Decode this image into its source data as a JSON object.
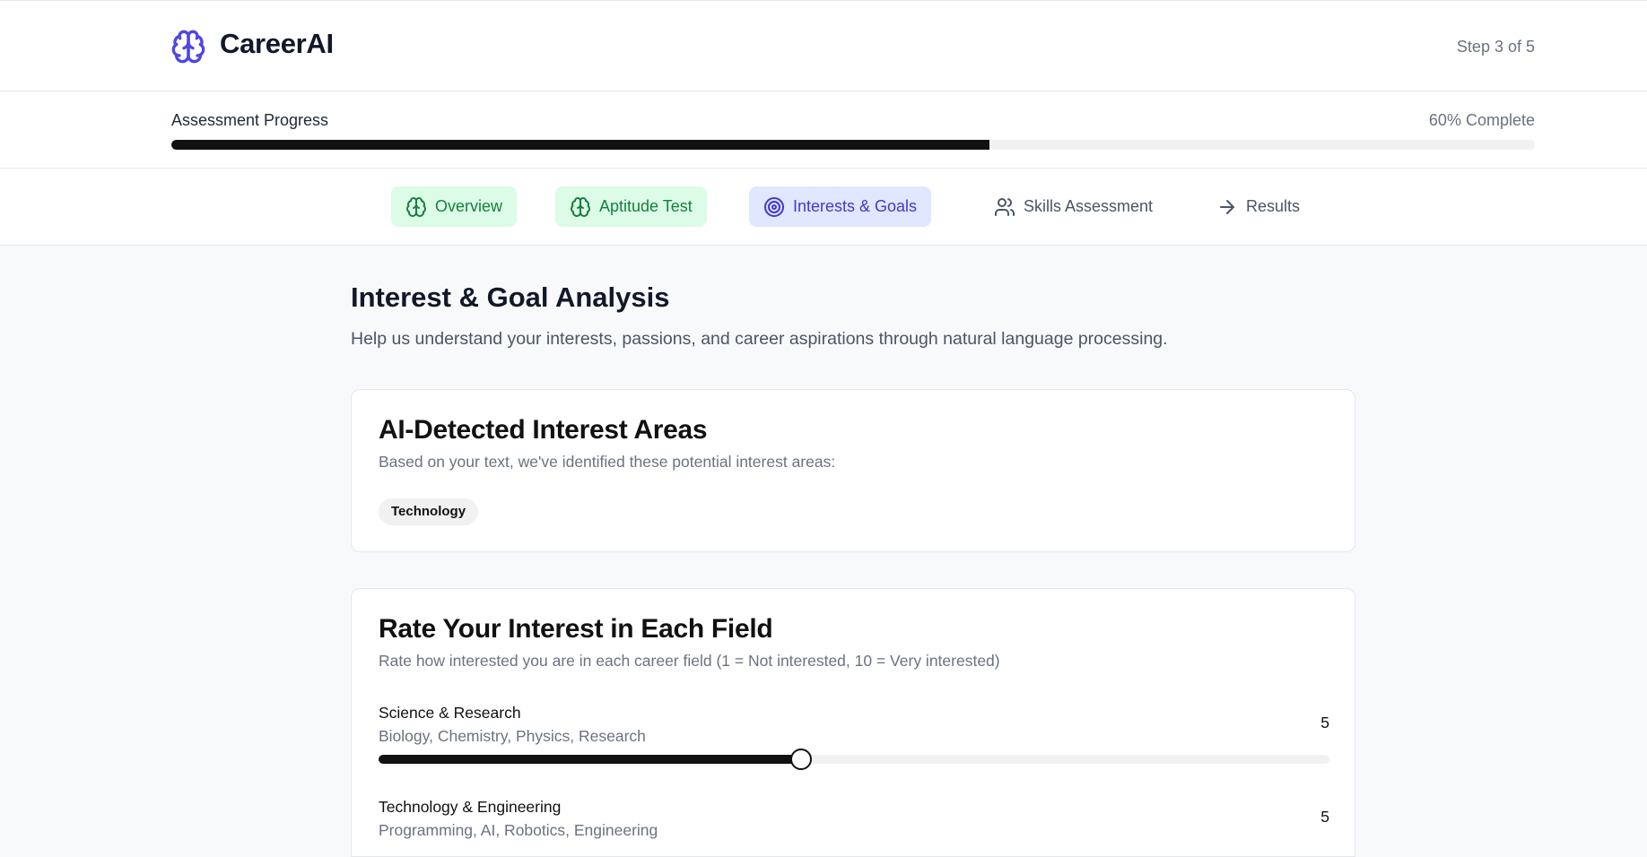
{
  "app": {
    "name": "CareerAI",
    "step_text": "Step 3 of 5"
  },
  "colors": {
    "brand": "#4f46e5",
    "done_bg": "#dcfce7",
    "done_text": "#15803d",
    "active_bg": "#e0e7ff",
    "active_text": "#4338ca",
    "progress": "#111111"
  },
  "progress": {
    "label": "Assessment Progress",
    "percent_text": "60% Complete",
    "value": 0.6
  },
  "tabs": [
    {
      "label": "Overview",
      "icon": "brain-icon",
      "state": "completed"
    },
    {
      "label": "Aptitude Test",
      "icon": "brain-icon",
      "state": "completed"
    },
    {
      "label": "Interests & Goals",
      "icon": "target-icon",
      "state": "active"
    },
    {
      "label": "Skills Assessment",
      "icon": "users-icon",
      "state": "pending"
    },
    {
      "label": "Results",
      "icon": "arrow-right-icon",
      "state": "pending"
    }
  ],
  "page": {
    "title": "Interest & Goal Analysis",
    "subtitle": "Help us understand your interests, passions, and career aspirations through natural language processing."
  },
  "detected": {
    "title": "AI-Detected Interest Areas",
    "subtitle": "Based on your text, we've identified these potential interest areas:",
    "tags": [
      "Technology"
    ]
  },
  "rating": {
    "title": "Rate Your Interest in Each Field",
    "subtitle": "Rate how interested you are in each career field (1 = Not interested, 10 = Very interested)",
    "min": 1,
    "max": 10,
    "fields": [
      {
        "name": "Science & Research",
        "description": "Biology, Chemistry, Physics, Research",
        "value": 5,
        "value_text": "5"
      },
      {
        "name": "Technology & Engineering",
        "description": "Programming, AI, Robotics, Engineering",
        "value": 5,
        "value_text": "5"
      }
    ]
  }
}
